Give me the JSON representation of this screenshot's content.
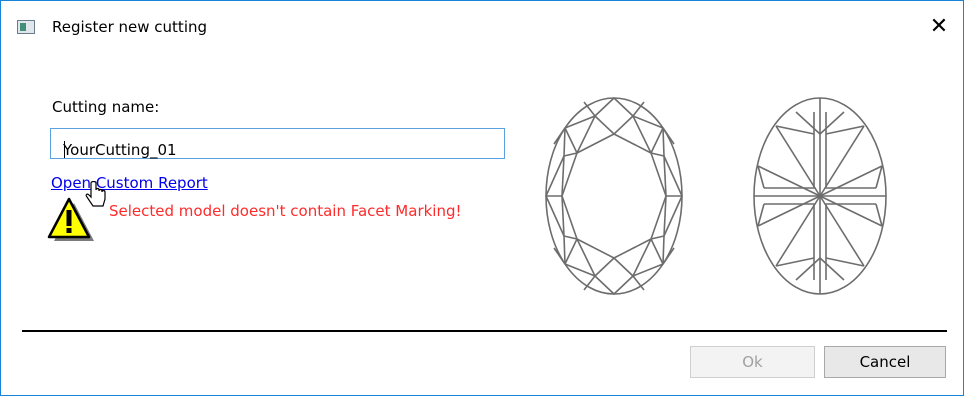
{
  "window": {
    "title": "Register new cutting",
    "close_glyph": "✕",
    "icon": "app-window-icon"
  },
  "form": {
    "label": "Cutting name:",
    "input_value": "YourCutting_01",
    "link_text": "Open Custom Report",
    "warning_text": "Selected model doesn't contain Facet Marking!",
    "warning_icon": "warning-icon",
    "cursor_icon": "hand-cursor-icon"
  },
  "images": {
    "crown": "oval-crown-view",
    "pavilion": "oval-pavilion-view"
  },
  "buttons": {
    "ok_label": "Ok",
    "cancel_label": "Cancel"
  },
  "colors": {
    "accent": "#1883d7",
    "link": "#0000ee",
    "warning": "#ff2b2b",
    "warning_icon_fill": "#ffff00",
    "gem_stroke": "#6d6d6d"
  }
}
